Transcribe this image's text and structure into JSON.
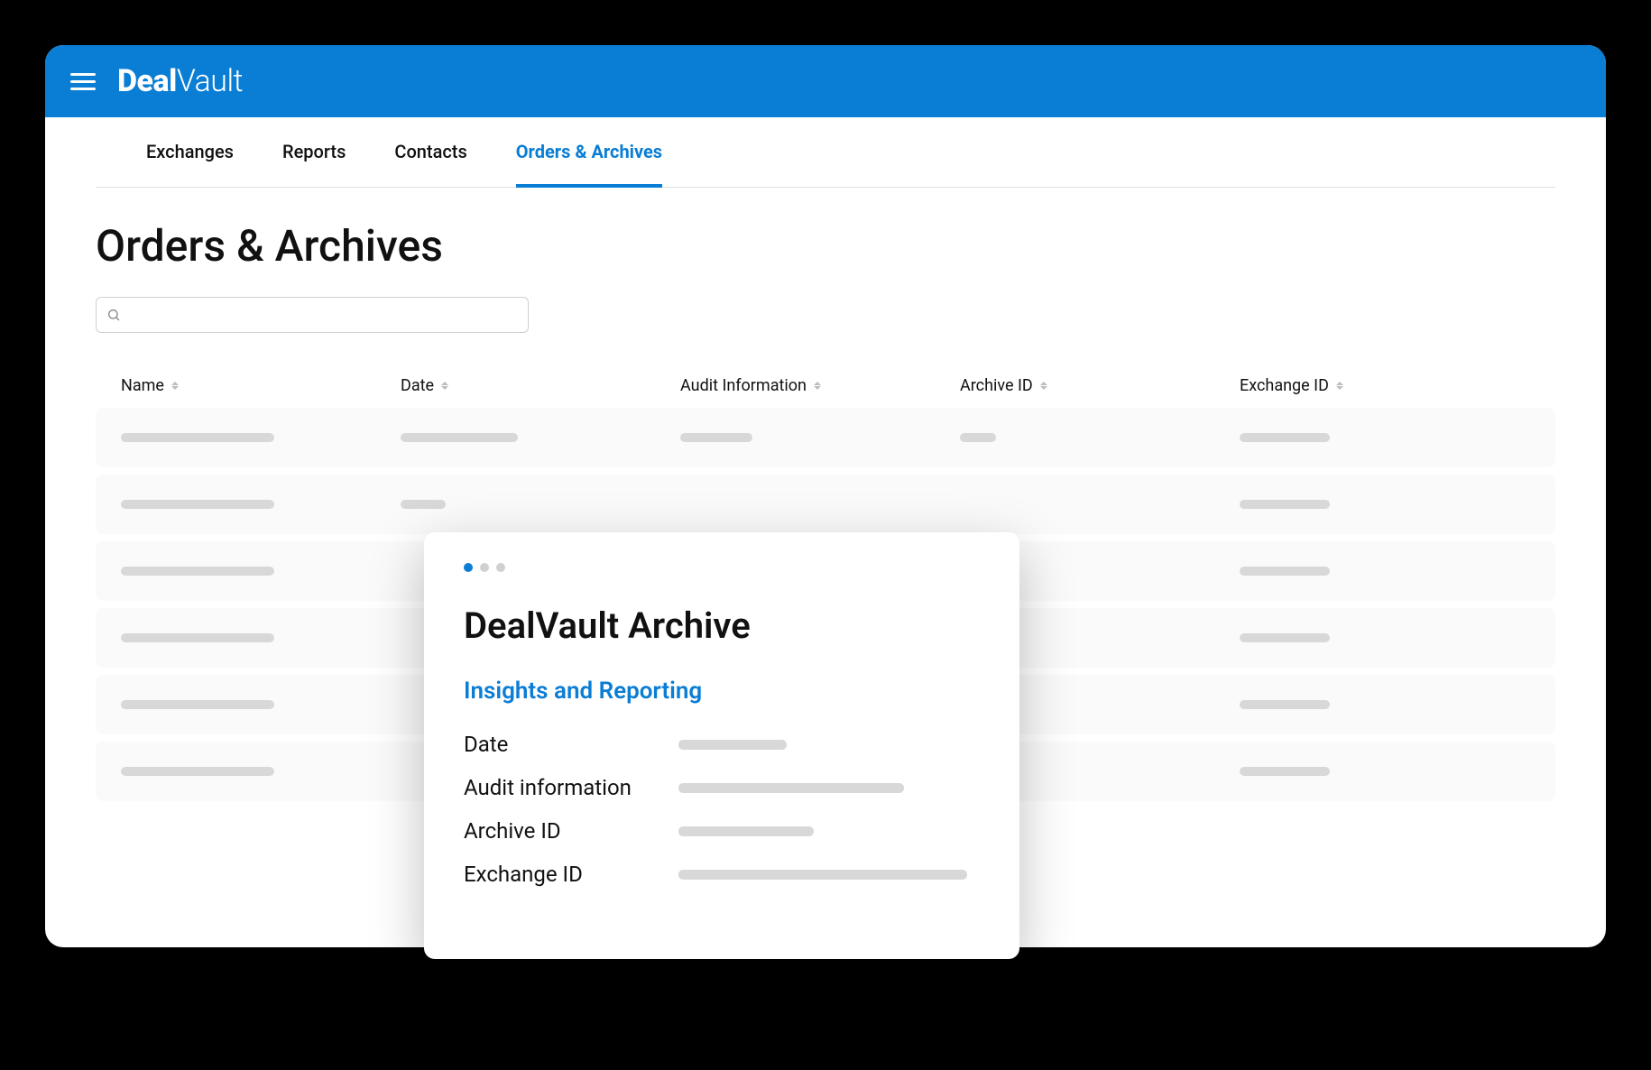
{
  "brand": {
    "bold": "Deal",
    "light": "Vault"
  },
  "tabs": [
    {
      "label": "Exchanges",
      "active": false
    },
    {
      "label": "Reports",
      "active": false
    },
    {
      "label": "Contacts",
      "active": false
    },
    {
      "label": "Orders & Archives",
      "active": true
    }
  ],
  "page": {
    "title": "Orders & Archives"
  },
  "search": {
    "placeholder": ""
  },
  "columns": {
    "name": "Name",
    "date": "Date",
    "audit": "Audit Information",
    "archive_id": "Archive ID",
    "exchange_id": "Exchange ID"
  },
  "rows_count": 6,
  "popup": {
    "title": "DealVault Archive",
    "subtitle": "Insights and Reporting",
    "fields": {
      "date": "Date",
      "audit": "Audit information",
      "archive_id": "Archive ID",
      "exchange_id": "Exchange ID"
    }
  }
}
